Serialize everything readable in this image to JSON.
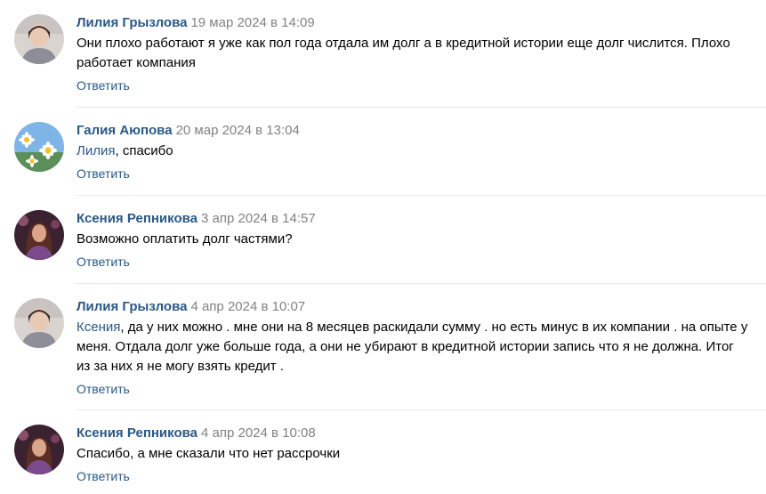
{
  "comments": [
    {
      "author": "Лилия Грызлова",
      "date": "19 мар 2024 в 14:09",
      "text": "Они плохо работают я уже как пол года отдала им долг а в кредитной истории еще долг числится. Плохо работает компания",
      "reply": "Ответить"
    },
    {
      "author": "Галия Аюпова",
      "date": "20 мар 2024 в 13:04",
      "mention": "Лилия",
      "text": ", спасибо",
      "reply": "Ответить"
    },
    {
      "author": "Ксения Репникова",
      "date": "3 апр 2024 в 14:57",
      "text": "Возможно оплатить долг частями?",
      "reply": "Ответить"
    },
    {
      "author": "Лилия Грызлова",
      "date": "4 апр 2024 в 10:07",
      "mention": "Ксения",
      "text": ", да у них можно . мне они на 8 месяцев раскидали сумму . но есть минус в их компании . на опыте у меня. Отдала долг уже больше года, а они не убирают в кредитной истории запись что я не должна. Итог из за них я не могу взять кредит .",
      "reply": "Ответить"
    },
    {
      "author": "Ксения Репникова",
      "date": "4 апр 2024 в 10:08",
      "text": "Спасибо, а мне сказали что нет рассрочки",
      "reply": "Ответить"
    }
  ],
  "colors": {
    "link": "#2a5885",
    "meta": "#828282",
    "divider": "#e7e8ec"
  }
}
